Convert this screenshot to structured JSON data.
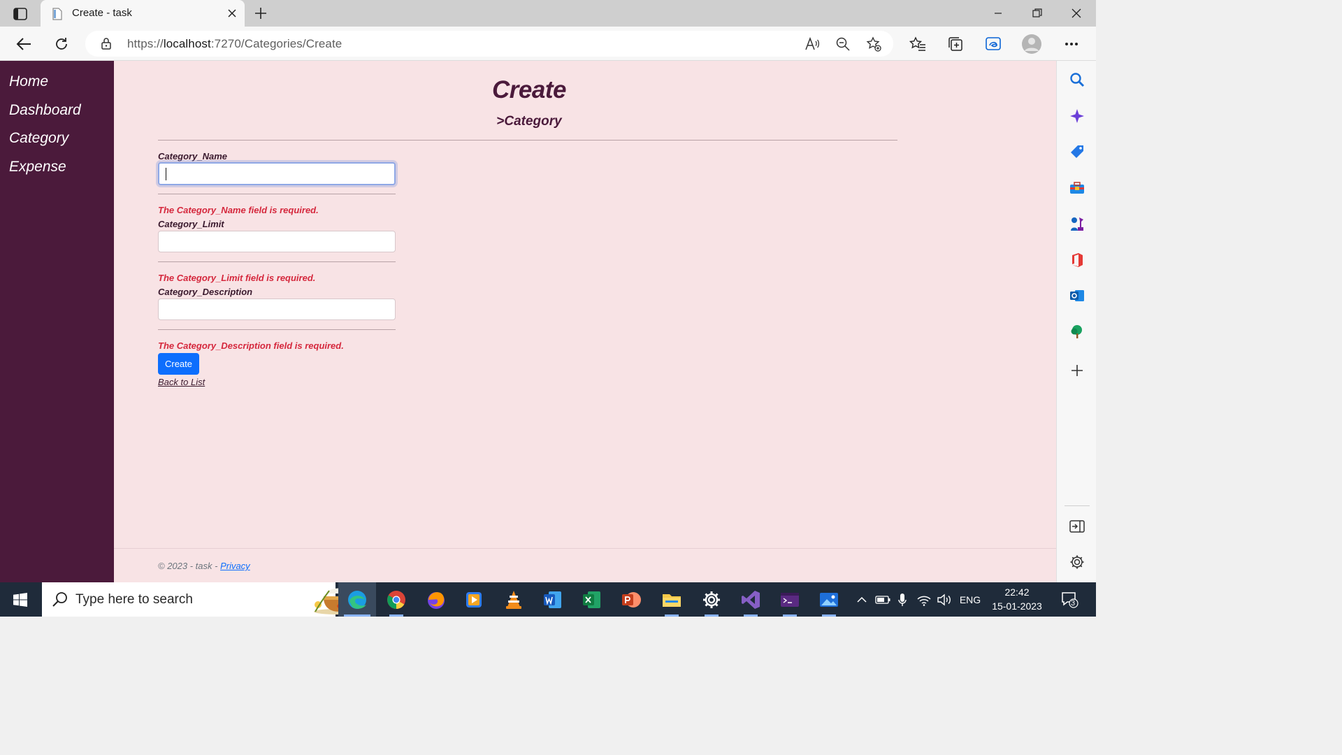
{
  "browser": {
    "tab_title": "Create - task",
    "url_scheme": "https://",
    "url_host": "localhost",
    "url_path": ":7270/Categories/Create"
  },
  "app": {
    "nav": [
      "Home",
      "Dashboard",
      "Category",
      "Expense"
    ],
    "title": "Create",
    "subtitle": ">Category",
    "form": {
      "fields": [
        {
          "label": "Category_Name",
          "value": "",
          "error": "The Category_Name field is required."
        },
        {
          "label": "Category_Limit",
          "value": "",
          "error": "The Category_Limit field is required."
        },
        {
          "label": "Category_Description",
          "value": "",
          "error": "The Category_Description field is required."
        }
      ],
      "submit_label": "Create",
      "back_link": "Back to List"
    },
    "footer_text": "© 2023 - task - ",
    "footer_link": "Privacy",
    "colors": {
      "sidebar": "#4b1a3b",
      "background": "#f8e3e5",
      "accent": "#0d6efd",
      "error": "#d5283d"
    }
  },
  "taskbar": {
    "search_placeholder": "Type here to search",
    "language": "ENG",
    "time": "22:42",
    "date": "15-01-2023",
    "notification_count": "3"
  }
}
